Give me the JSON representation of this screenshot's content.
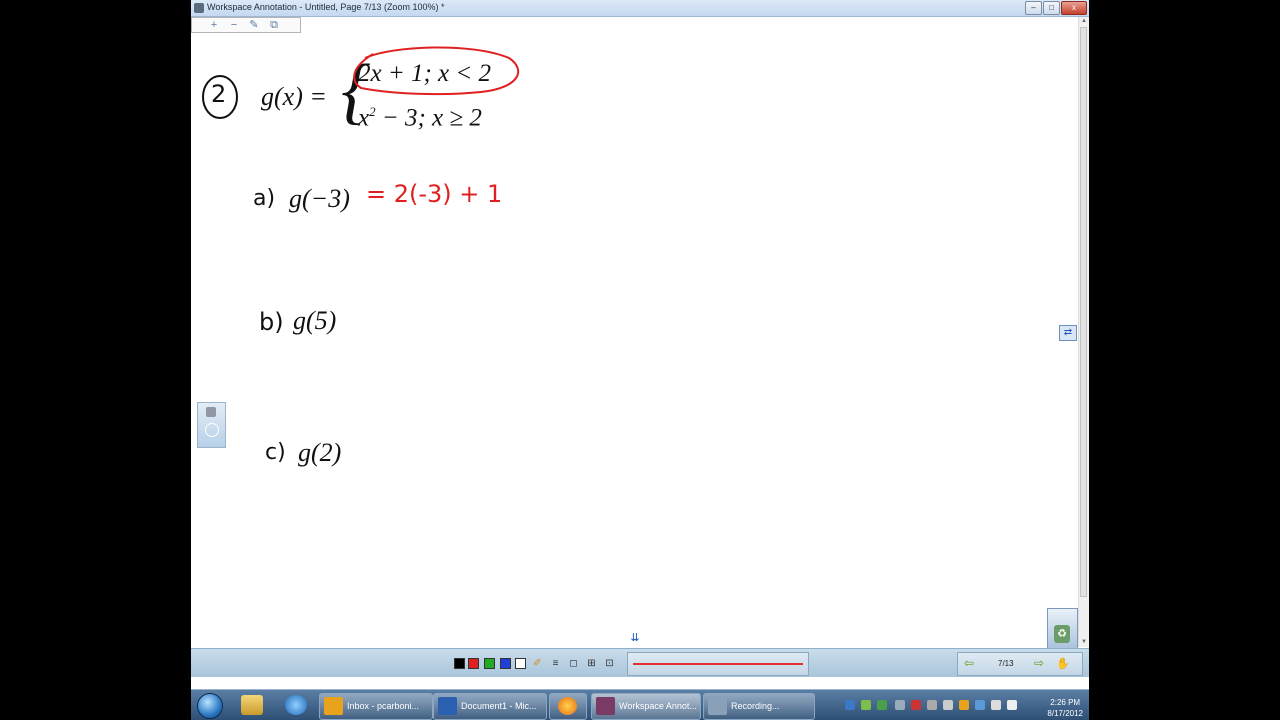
{
  "window": {
    "title": "Workspace Annotation - Untitled, Page 7/13  (Zoom 100%) *",
    "controls": {
      "minimize": "–",
      "maximize": "□",
      "close": "x"
    }
  },
  "annotation_toolbar": {
    "icons": [
      "plus-icon",
      "minus-icon",
      "edit-icon",
      "copy-icon"
    ],
    "labels": {
      "add": "+",
      "remove": "−",
      "edit": "✎",
      "copy": "⧉"
    }
  },
  "content": {
    "problem_number": "2",
    "function_lhs": "g(x) =",
    "brace": "{",
    "case1": "2x + 1;  x < 2",
    "case2_base": "x",
    "case2_exp": "2",
    "case2_rest": " − 3;  x ≥ 2",
    "part_a_label": "a)",
    "part_a_expr": "g(−3)",
    "part_a_work": "= 2(-3) + 1",
    "part_b_label": "b)",
    "part_b_expr": "g(5)",
    "part_c_label": "c)",
    "part_c_expr": "g(2)"
  },
  "side": {
    "swap_glyph": "⇄",
    "expand_glyph": "⇊",
    "recycle_glyph": "♻"
  },
  "pen_toolbar": {
    "colors": [
      "#000000",
      "#e02020",
      "#22aa22",
      "#1f3fd8",
      "#ffffff"
    ],
    "tools": {
      "highlighter": "✐",
      "lines": "≡",
      "eraser": "◻",
      "grid": "⊞",
      "lasso": "⊡"
    },
    "pen_color": "#e23030",
    "page_indicator": "7/13",
    "prev": "⇦",
    "next": "⇨",
    "hand": "✋"
  },
  "taskbar": {
    "tasks": [
      {
        "label": "Inbox - pcarboni...",
        "icon": "outlook-icon",
        "color": "#e8a31c"
      },
      {
        "label": "Document1 - Mic...",
        "icon": "word-icon",
        "color": "#2b5fb0"
      },
      {
        "label": "",
        "icon": "firefox-icon",
        "color": "#e86a17"
      },
      {
        "label": "Workspace Annot...",
        "icon": "workspace-icon",
        "color": "#7a3a66"
      },
      {
        "label": "Recording...",
        "icon": "recording-icon",
        "color": "#8aa0b8"
      }
    ],
    "clock_time": "2:26 PM",
    "clock_date": "8/17/2012"
  }
}
